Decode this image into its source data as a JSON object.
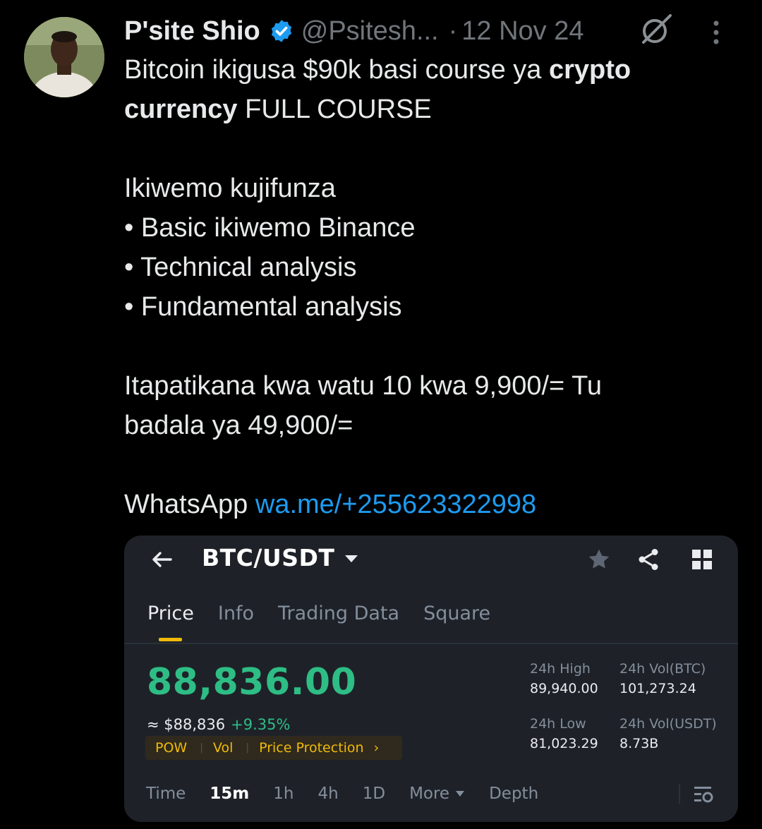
{
  "tweet": {
    "author": {
      "name": "P'site Shio",
      "handle": "@Psitesh...",
      "verified": true
    },
    "date": "12 Nov 24",
    "separator": "·",
    "line1_text": "Bitcoin ikigusa $90k basi course ya ",
    "line1_bold": "crypto",
    "line2_bold": "currency",
    "line2_text": " FULL COURSE",
    "intro": "Ikiwemo kujifunza",
    "bullets": [
      "• Basic ikiwemo Binance",
      "• Technical analysis",
      "• Fundamental analysis"
    ],
    "offer_line1": "Itapatikana kwa watu 10 kwa 9,900/= Tu",
    "offer_line2": "badala ya 49,900/=",
    "contact_label": "WhatsApp ",
    "contact_link": "wa.me/+255623322998",
    "colors": {
      "link": "#1d9bf0",
      "verified": "#1d9bf0",
      "muted": "#71767b"
    }
  },
  "card": {
    "pair": "BTC/USDT",
    "tabs": [
      "Price",
      "Info",
      "Trading Data",
      "Square"
    ],
    "active_tab": "Price",
    "last_price": "88,836.00",
    "fiat_price": "≈ $88,836",
    "change": "+9.35%",
    "tags": [
      "POW",
      "Vol",
      "Price Protection"
    ],
    "tag_arrow": "›",
    "high_label": "24h High",
    "high_value": "89,940.00",
    "low_label": "24h Low",
    "low_value": "81,023.29",
    "vol_btc_label": "24h Vol(BTC)",
    "vol_btc_value": "101,273.24",
    "vol_usdt_label": "24h Vol(USDT)",
    "vol_usdt_value": "8.73B",
    "intervals": [
      "Time",
      "15m",
      "1h",
      "4h",
      "1D"
    ],
    "selected_interval": "15m",
    "more_label": "More",
    "depth_label": "Depth",
    "colors": {
      "up": "#2ebd85",
      "accent": "#f0b90b",
      "bg": "#1e2228"
    },
    "icons": [
      "back-arrow-icon",
      "caret-down-icon",
      "star-icon",
      "share-icon",
      "grid-icon",
      "chart-settings-icon"
    ]
  }
}
